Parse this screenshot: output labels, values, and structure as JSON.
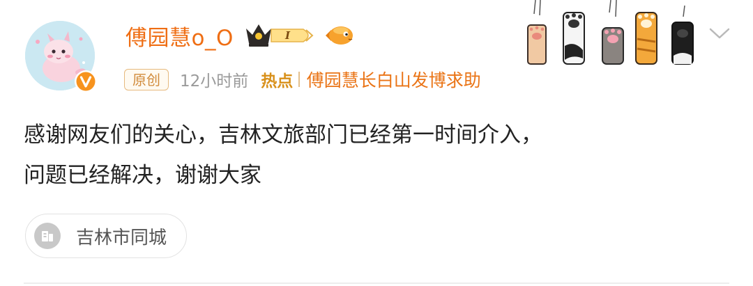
{
  "post": {
    "author": "傅园慧o_O",
    "vip_level": "I",
    "original_badge": "原创",
    "time": "12小时前",
    "hot_label": "热点",
    "topic": "傅园慧长白山发博求助",
    "content_lines": [
      "感谢网友们的关心，吉林文旅部门已经第一时间介入，",
      "问题已经解决，谢谢大家"
    ],
    "location": "吉林市同城"
  },
  "colors": {
    "name": "#ef6e14",
    "badge_border": "#e6b97d",
    "hot": "#d8901a",
    "meta": "#9a9a9a"
  },
  "icons": {
    "avatar": "cartoon-dragon-avatar",
    "verified": "orange-v-verified-icon",
    "vip": "crown-vip-badge",
    "fish": "orange-fish-icon",
    "paws": "cat-paws-decoration",
    "expand": "chevron-down-icon",
    "location": "building-icon"
  }
}
